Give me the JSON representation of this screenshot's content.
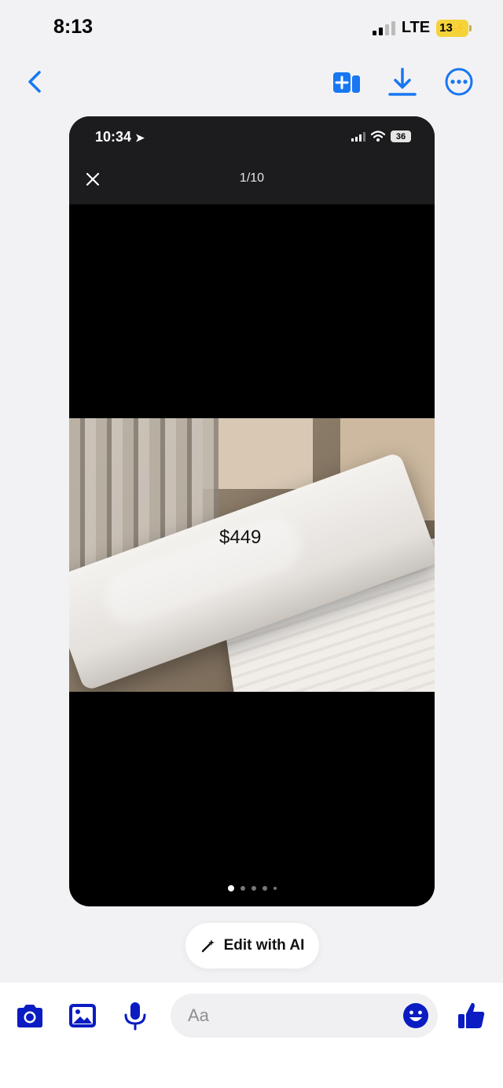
{
  "status_bar": {
    "time": "8:13",
    "network": "LTE",
    "battery": "13"
  },
  "viewer": {
    "inner_status": {
      "time": "10:34",
      "battery": "36"
    },
    "counter": "1/10",
    "price_overlay": "$449",
    "page_dots": {
      "count": 5,
      "active_index": 0
    }
  },
  "edit_ai": {
    "label": "Edit with AI"
  },
  "composer": {
    "placeholder": "Aa"
  },
  "colors": {
    "accent": "#1877f2",
    "messenger_blue": "#0a1cc2",
    "background": "#f2f2f4"
  },
  "icons": [
    "back-icon",
    "add-to-album-icon",
    "download-icon",
    "more-icon",
    "camera-icon",
    "gallery-icon",
    "microphone-icon",
    "emoji-icon",
    "like-icon",
    "sparkle-pen-icon",
    "close-icon"
  ]
}
